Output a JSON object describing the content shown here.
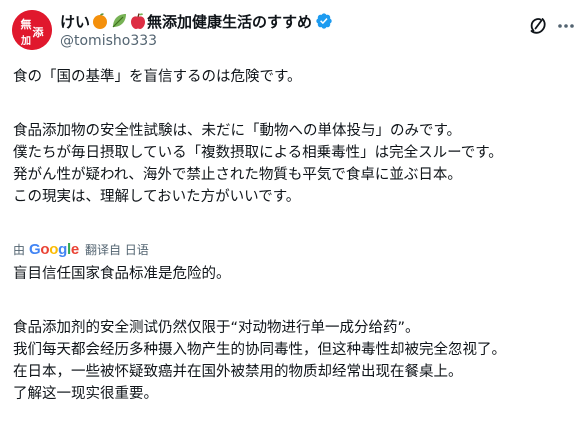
{
  "author": {
    "display_name_prefix": "けい",
    "display_name_suffix": "無添加健康生活のすすめ",
    "handle": "@tomisho333",
    "avatar_text": "無添加",
    "emojis": [
      "orange-icon",
      "leaf-icon",
      "apple-icon"
    ],
    "accent_color": "#e0182d",
    "verified_color": "#1d9bf0"
  },
  "actions": {
    "grok_icon": "grok-icon",
    "more_icon": "more-icon"
  },
  "original_text": {
    "line1": "食の「国の基準」を盲信するのは危険です。",
    "line2": "食品添加物の安全性試験は、未だに「動物への単体投与」のみです。",
    "line3": "僕たちが毎日摂取している「複数摂取による相乗毒性」は完全スルーです。",
    "line4": "発がん性が疑われ、海外で禁止された物質も平気で食卓に並ぶ日本。",
    "line5": "この現実は、理解しておいた方がいいです。"
  },
  "translation_bar": {
    "by_label": "由",
    "google_letters": [
      "G",
      "o",
      "o",
      "g",
      "l",
      "e"
    ],
    "translated_from": "翻译自 日语"
  },
  "translated_text": {
    "line1": "盲目信任国家食品标准是危险的。",
    "line2": "食品添加剂的安全测试仍然仅限于“对动物进行单一成分给药”。",
    "line3": "我们每天都会经历多种摄入物产生的协同毒性，但这种毒性却被完全忽视了。",
    "line4": "在日本，一些被怀疑致癌并在国外被禁用的物质却经常出现在餐桌上。",
    "line5": "了解这一现实很重要。"
  }
}
